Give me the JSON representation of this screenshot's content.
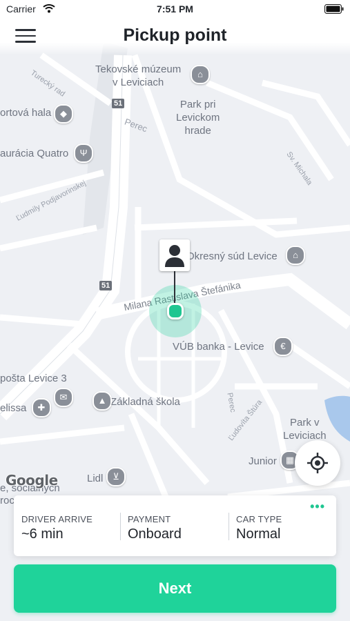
{
  "status_bar": {
    "carrier": "Carrier",
    "time": "7:51 PM"
  },
  "nav": {
    "title": "Pickup point"
  },
  "map": {
    "labels": {
      "tekovske_muzeum": "Tekovské múzeum\nv Leviciach",
      "park_pri_levickom_hrade": "Park pri\nLevickom\nhrade",
      "sportova_hala": "ortová hala",
      "restauracia_quatro": "aurácia Quatro",
      "okresny_sud": "Okresný súd Levice",
      "vub_banka": "VÚB banka - Levice",
      "posta": "pošta Levice 3",
      "elissa": "elissa",
      "zakladna_skola": "Základná škola",
      "park_v_leviciach": "Park v\nLeviciach",
      "junior": "Junior",
      "lidl": "Lidl",
      "socialnych": "e, sociálnych",
      "roc": "roc",
      "street_turecky_rad": "Turecký rad",
      "street_perec": "Perec",
      "street_perec2": "Perec",
      "street_podjavorinskej": "Ľudmily Podjavorinskej",
      "street_sv_michala": "Sv. Michala",
      "street_stefanika": "Milana Rastislava Štefánika",
      "street_stura": "Ľudovíta Štúra",
      "route_51_a": "51",
      "route_51_b": "51"
    },
    "attribution": "Google"
  },
  "info_card": {
    "driver_arrive_label": "DRIVER ARRIVE",
    "driver_arrive_value": "~6 min",
    "payment_label": "PAYMENT",
    "payment_value": "Onboard",
    "car_type_label": "CAR TYPE",
    "car_type_value": "Normal",
    "more": "•••"
  },
  "next_button": {
    "label": "Next"
  },
  "colors": {
    "accent": "#1fd39a",
    "pin": "#1fc691",
    "map_bg": "#eef0f4",
    "road": "#ffffff"
  }
}
